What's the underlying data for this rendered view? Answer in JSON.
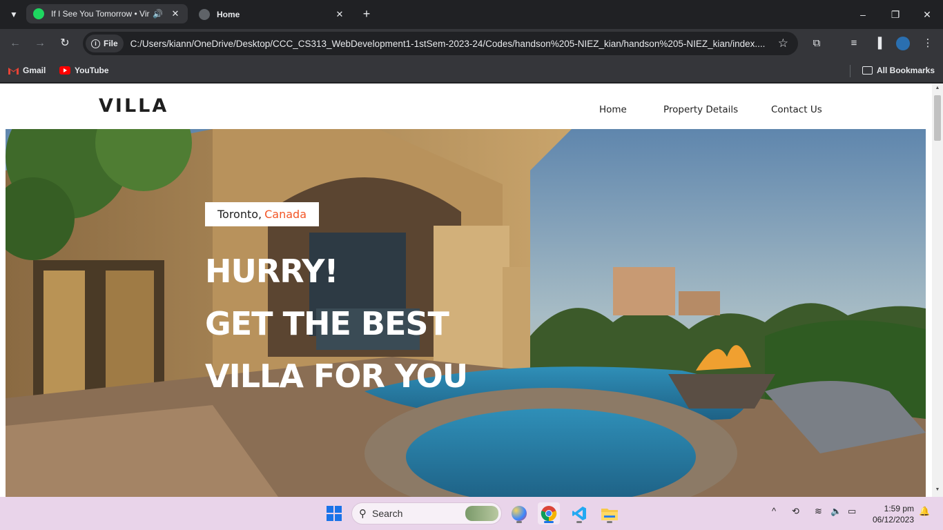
{
  "browser": {
    "tabs": [
      {
        "title": "If I See You Tomorrow • Vir",
        "favicon": "spotify-icon",
        "audio": true
      },
      {
        "title": "Home",
        "favicon": "globe-icon",
        "audio": false
      }
    ],
    "address": {
      "chip": "File",
      "url": "C:/Users/kiann/OneDrive/Desktop/CCC_CS313_WebDevelopment1-1stSem-2023-24/Codes/handson%205-NIEZ_kian/handson%205-NIEZ_kian/index...."
    },
    "bookmarks": [
      {
        "label": "Gmail",
        "icon": "gmail-icon"
      },
      {
        "label": "YouTube",
        "icon": "youtube-icon"
      }
    ],
    "all_bookmarks": "All Bookmarks"
  },
  "site": {
    "logo": "VILLA",
    "nav": [
      "Home",
      "Property Details",
      "Contact Us"
    ],
    "hero": {
      "city": "Toronto,",
      "country": "Canada",
      "accent_color": "#f35525",
      "lines": [
        "HURRY!",
        "GET THE BEST",
        "VILLA FOR YOU"
      ]
    }
  },
  "taskbar": {
    "search_placeholder": "Search",
    "time": "1:59 pm",
    "date": "06/12/2023"
  }
}
